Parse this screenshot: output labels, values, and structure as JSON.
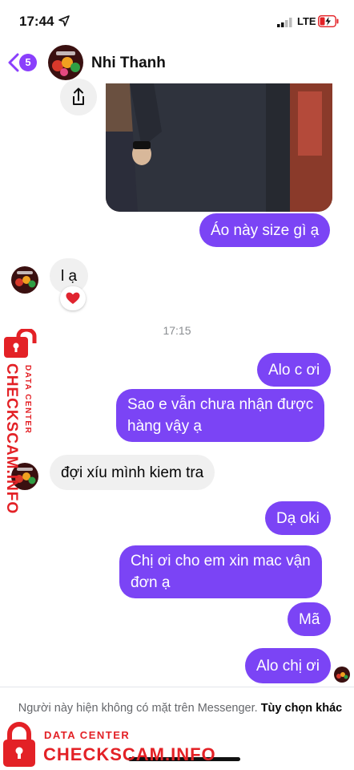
{
  "status_bar": {
    "time": "17:44",
    "network": "LTE"
  },
  "header": {
    "back_count": "5",
    "contact_name": "Nhi Thanh"
  },
  "messages": [
    {
      "id": "m1",
      "side": "out",
      "text": "Áo này size gì ạ"
    },
    {
      "id": "m2",
      "side": "in",
      "text": "l ạ",
      "reaction": "❤️"
    },
    {
      "id": "m3",
      "side": "out",
      "text": "Alo c ơi"
    },
    {
      "id": "m4",
      "side": "out",
      "lines": [
        "Sao e vẫn chưa nhận được",
        "hàng vậy ạ"
      ]
    },
    {
      "id": "m5",
      "side": "in",
      "text": "đợi xíu mình kiem tra"
    },
    {
      "id": "m6",
      "side": "out",
      "text": "Dạ oki"
    },
    {
      "id": "m7",
      "side": "out",
      "lines": [
        "Chị ơi cho em xin mac vận",
        "đơn ạ"
      ]
    },
    {
      "id": "m8",
      "side": "out",
      "text": "Mã"
    },
    {
      "id": "m9",
      "side": "out",
      "text": "Alo chị ơi"
    }
  ],
  "timestamp": "17:15",
  "footer": {
    "notice_text": "Người này hiện không có mặt trên Messenger.",
    "notice_link": "Tùy chọn khác"
  },
  "watermark": {
    "brand": "CHECKSCAM.INFO",
    "sub": "DATA CENTER"
  },
  "colors": {
    "outgoing_bubble": "#7b44f5",
    "incoming_bubble": "#f0f0f0",
    "accent": "#8a3ffc",
    "watermark": "#e32126"
  }
}
